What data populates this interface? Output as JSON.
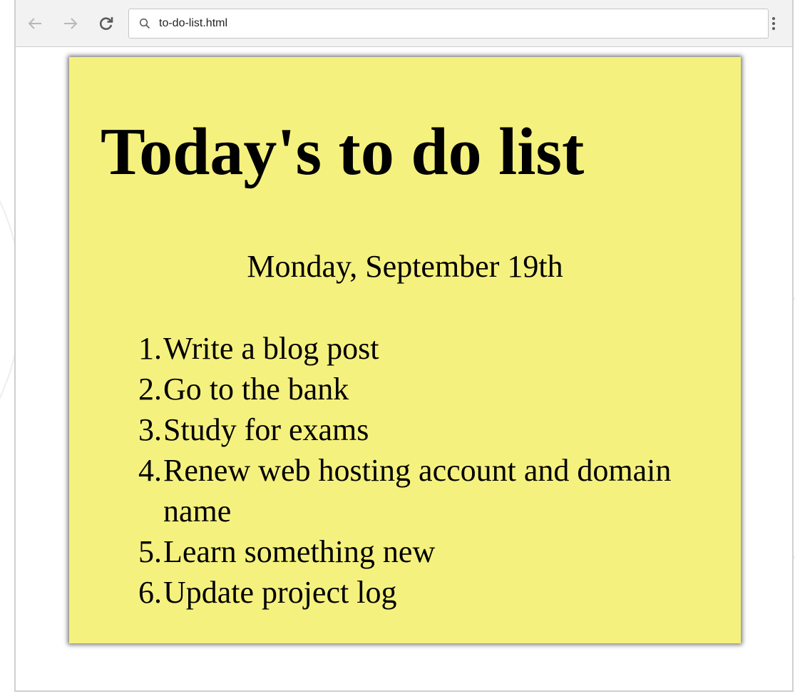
{
  "browser": {
    "url": "to-do-list.html"
  },
  "page": {
    "title": "Today's to do list",
    "date": "Monday, September 19th",
    "items": [
      {
        "number": "1.",
        "text": "Write a blog post"
      },
      {
        "number": "2.",
        "text": "Go to the bank"
      },
      {
        "number": "3.",
        "text": "Study for exams"
      },
      {
        "number": "4.",
        "text": "Renew web hosting account and domain name"
      },
      {
        "number": "5.",
        "text": "Learn something new"
      },
      {
        "number": "6.",
        "text": "Update project log"
      }
    ]
  },
  "icons": {
    "back": "arrow-left-icon",
    "forward": "arrow-right-icon",
    "reload": "reload-icon",
    "search": "search-icon",
    "menu": "kebab-menu-icon"
  },
  "colors": {
    "note_background": "#f5f17e",
    "toolbar_background": "#f2f2f2"
  }
}
